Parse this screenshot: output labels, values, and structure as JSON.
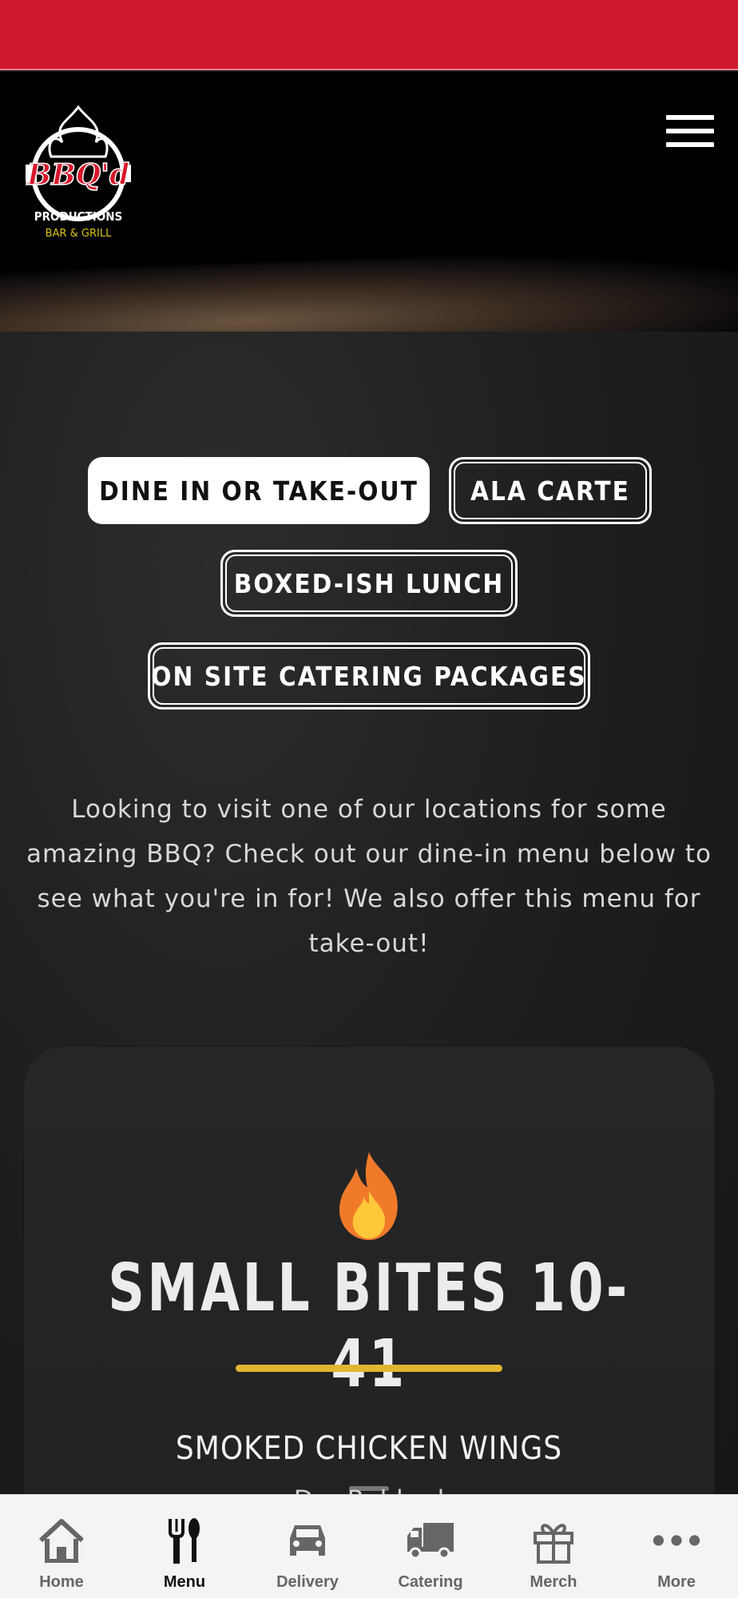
{
  "header": {
    "logo_text": "BBQ'd PRODUCTIONS BAR & GRILL",
    "menu_icon": "hamburger-icon"
  },
  "menu_tabs": [
    {
      "label": "DINE IN OR TAKE-OUT",
      "active": true
    },
    {
      "label": "ALA CARTE",
      "active": false
    },
    {
      "label": "BOXED-ISH LUNCH",
      "active": false
    },
    {
      "label": "ON SITE CATERING PACKAGES",
      "active": false
    }
  ],
  "intro": "Looking to visit one of our locations for some amazing BBQ? Check out our dine-in menu below to see what you're in for! We also offer this menu for take-out!",
  "section": {
    "icon": "flame-icon",
    "title": "SMALL BITES 10-41",
    "first_item": {
      "name": "SMOKED CHICKEN WINGS",
      "desc": "Dry Rubbed"
    }
  },
  "bottom_nav": [
    {
      "label": "Home",
      "icon": "home-icon",
      "active": false
    },
    {
      "label": "Menu",
      "icon": "fork-knife-icon",
      "active": true
    },
    {
      "label": "Delivery",
      "icon": "car-icon",
      "active": false
    },
    {
      "label": "Catering",
      "icon": "truck-icon",
      "active": false
    },
    {
      "label": "Merch",
      "icon": "gift-icon",
      "active": false
    },
    {
      "label": "More",
      "icon": "more-dots-icon",
      "active": false
    }
  ],
  "colors": {
    "top_bar": "#cf1a2e",
    "accent_rule": "#e2b531",
    "flame_outer": "#f07a2a",
    "flame_inner": "#ffc83a"
  }
}
